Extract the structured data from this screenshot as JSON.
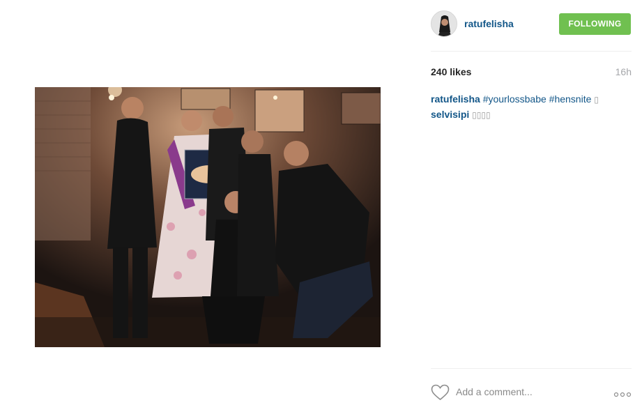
{
  "post": {
    "image_alt": "Group of friends posing at a hen night party",
    "author": {
      "username": "ratufelisha",
      "follow_label": "FOLLOWING"
    },
    "likes_text": "240 likes",
    "time_ago": "16h",
    "comments": [
      {
        "user": "ratufelisha",
        "tags": [
          "#yourlossbabe",
          "#hensnite"
        ],
        "trailing": "▯"
      },
      {
        "user": "selvisipi",
        "text": "▯▯▯▯"
      }
    ],
    "comment_input": {
      "placeholder": "Add a comment..."
    },
    "icons": {
      "like": "heart-icon",
      "more": "more-options-icon"
    }
  },
  "colors": {
    "link_blue": "#125688",
    "following_green": "#70c050",
    "muted_gray": "#a5a7aa",
    "divider": "#efefef"
  }
}
